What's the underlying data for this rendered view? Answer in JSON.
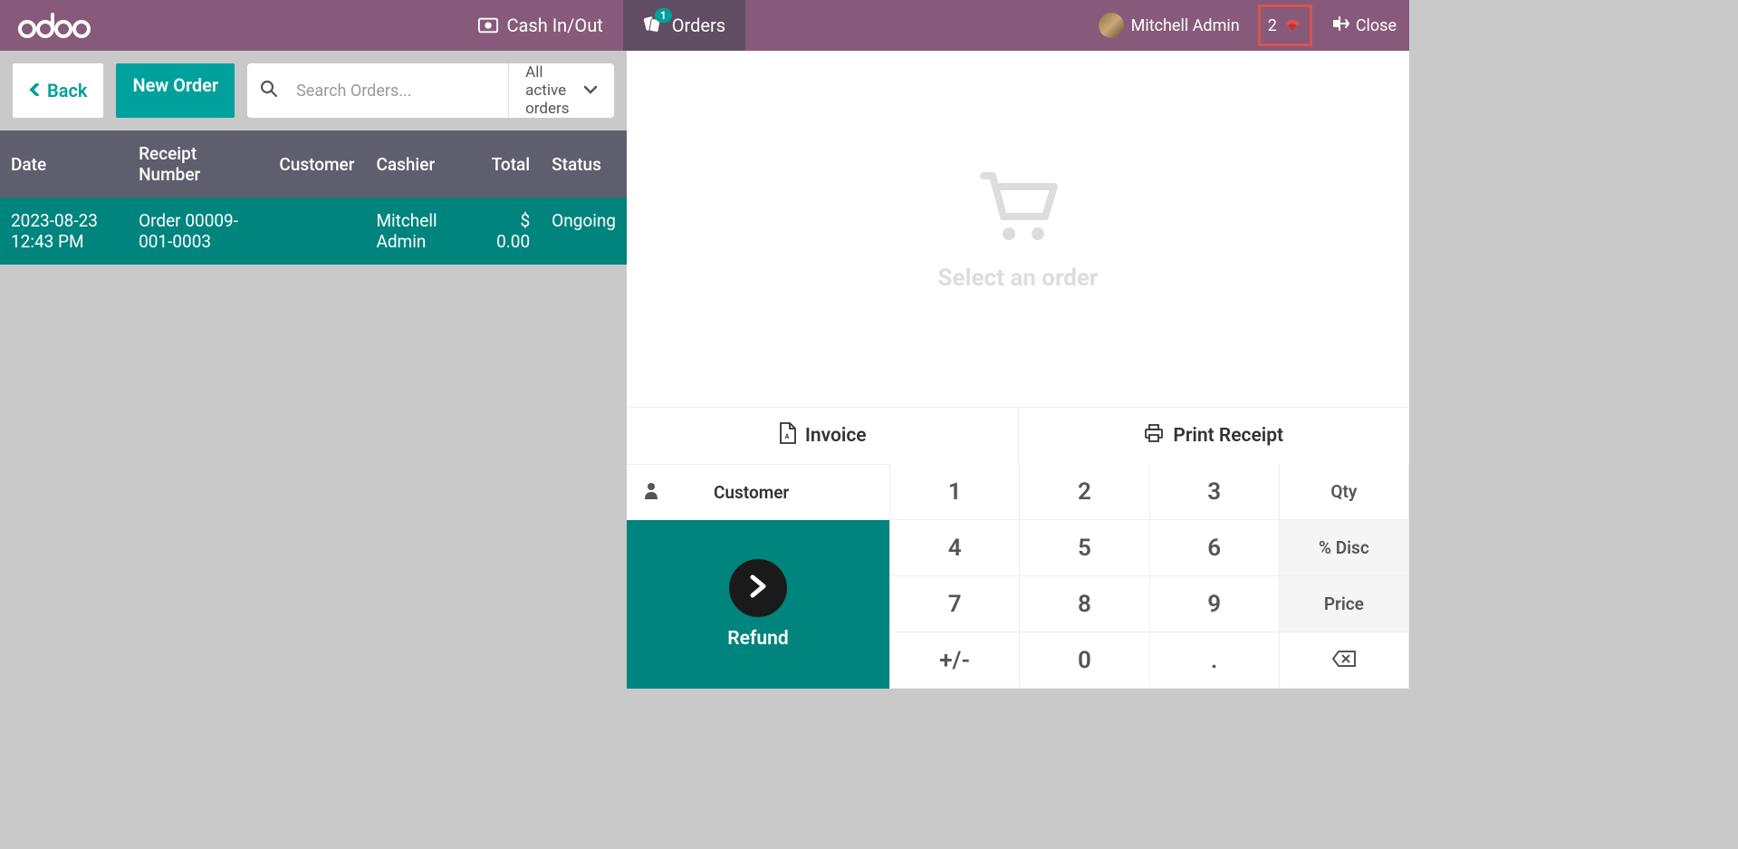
{
  "header": {
    "logo_text": "odoo",
    "cash_label": "Cash In/Out",
    "orders_label": "Orders",
    "orders_badge": "1",
    "user_name": "Mitchell Admin",
    "sync_count": "2",
    "close_label": "Close"
  },
  "toolbar": {
    "back_label": "Back",
    "new_order_label": "New Order",
    "search_placeholder": "Search Orders...",
    "filter_label": "All active orders"
  },
  "table": {
    "headers": {
      "date": "Date",
      "receipt": "Receipt Number",
      "customer": "Customer",
      "cashier": "Cashier",
      "total": "Total",
      "status": "Status"
    },
    "rows": [
      {
        "date": "2023-08-23 12:43 PM",
        "receipt": "Order 00009-001-0003",
        "customer": "",
        "cashier": "Mitchell Admin",
        "total": "$ 0.00",
        "status": "Ongoing"
      }
    ]
  },
  "right": {
    "empty_text": "Select an order",
    "invoice_label": "Invoice",
    "print_label": "Print Receipt",
    "customer_label": "Customer",
    "refund_label": "Refund"
  },
  "numpad": {
    "k1": "1",
    "k2": "2",
    "k3": "3",
    "fn_qty": "Qty",
    "k4": "4",
    "k5": "5",
    "k6": "6",
    "fn_disc": "% Disc",
    "k7": "7",
    "k8": "8",
    "k9": "9",
    "fn_price": "Price",
    "pm": "+/-",
    "k0": "0"
  }
}
